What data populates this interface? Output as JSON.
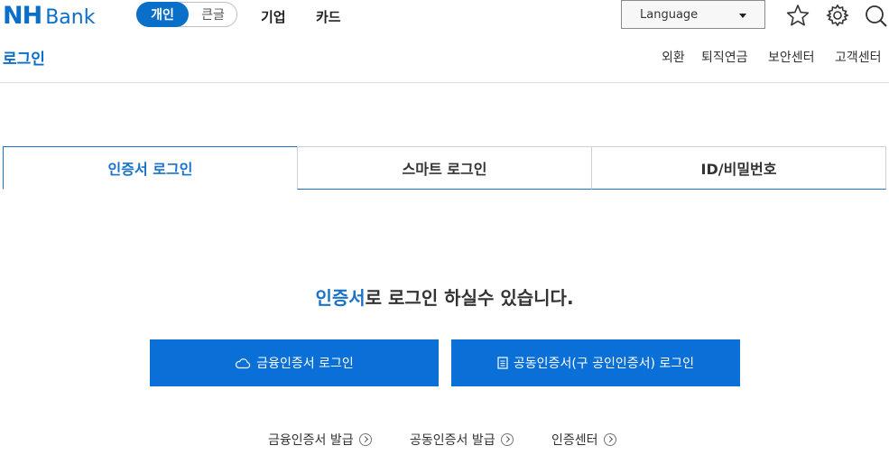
{
  "header": {
    "logo_nh": "NH",
    "logo_bank": "Bank",
    "segment": {
      "active": "개인",
      "inactive": "큰글"
    },
    "nav": [
      "기업",
      "카드"
    ],
    "language_label": "Language",
    "icons": [
      "star-icon",
      "gear-icon",
      "search-icon"
    ]
  },
  "page": {
    "title": "로그인",
    "utility_links": [
      "외환",
      "퇴직연금",
      "보안센터",
      "고객센터"
    ]
  },
  "tabs": [
    {
      "label": "인증서 로그인",
      "active": true
    },
    {
      "label": "스마트 로그인",
      "active": false
    },
    {
      "label": "ID/비밀번호",
      "active": false
    }
  ],
  "main": {
    "message_highlight": "인증서",
    "message_rest": "로 로그인 하실수 있습니다.",
    "buttons": [
      {
        "label": "금융인증서 로그인",
        "icon": "cloud-icon"
      },
      {
        "label": "공동인증서(구 공인인증서) 로그인",
        "icon": "document-icon"
      }
    ],
    "links": [
      "금융인증서 발급",
      "공동인증서 발급",
      "인증센터"
    ]
  },
  "colors": {
    "brand": "#0a6fc9",
    "button": "#0a6fd6",
    "tab_active": "#1a73c8"
  }
}
